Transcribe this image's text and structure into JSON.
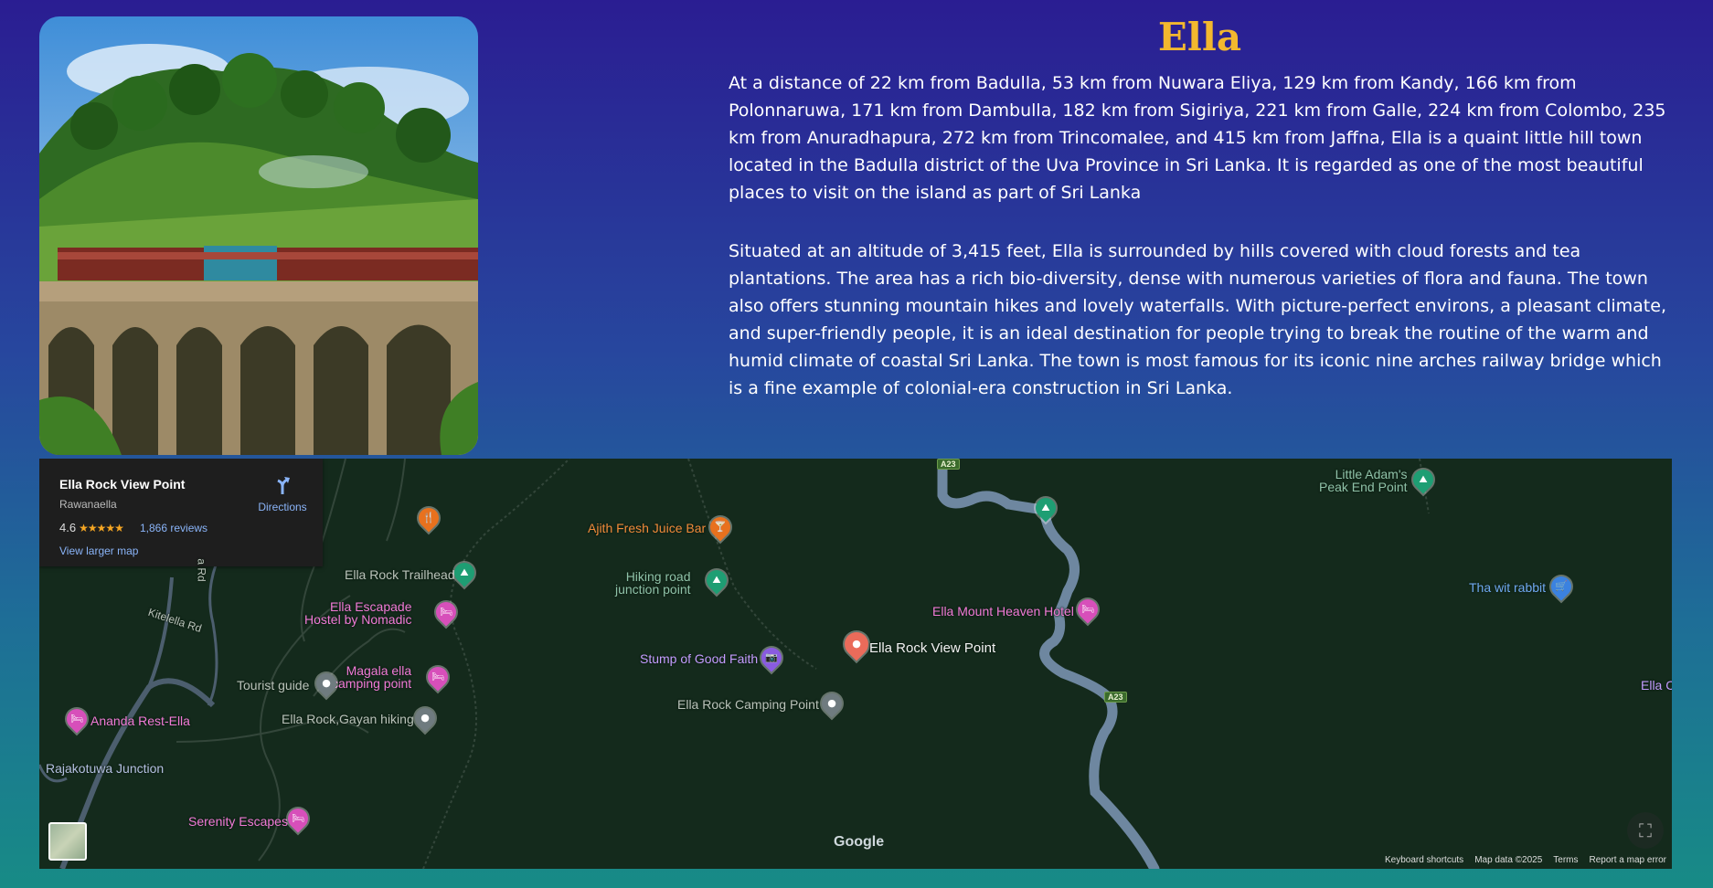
{
  "title": "Ella",
  "paragraphs": [
    "At a distance of 22 km from Badulla, 53 km from Nuwara Eliya, 129 km from Kandy, 166 km from Polonnaruwa, 171 km from Dambulla, 182 km from Sigiriya, 221 km from Galle, 224 km from Colombo, 235 km from Anuradhapura, 272 km from Trincomalee, and 415 km from Jaffna, Ella is a quaint little hill town located in the Badulla district of the Uva Province in Sri Lanka. It is regarded as one of the most beautiful places to visit on the island as part of Sri Lanka",
    "Situated at an altitude of 3,415 feet, Ella is surrounded by hills covered with cloud forests and tea plantations. The area has a rich bio-diversity, dense with numerous varieties of flora and fauna. The town also offers stunning mountain hikes and lovely waterfalls. With picture-perfect environs, a pleasant climate, and super-friendly people, it is an ideal destination for people trying to break the routine of the warm and humid climate of coastal Sri Lanka. The town is most famous for its iconic nine arches railway bridge which is a fine example of colonial-era construction in Sri Lanka."
  ],
  "colors": {
    "title": "#f3b82e",
    "text": "#ffffff",
    "map_bg": "#142a1c",
    "link": "#8ab4f8"
  },
  "map": {
    "card": {
      "place": "Ella Rock View Point",
      "area": "Rawanaella",
      "rating": "4.6",
      "stars": "★★★★★",
      "reviews": "1,866 reviews",
      "larger_map": "View larger map",
      "directions": "Directions"
    },
    "labels": {
      "selected": "Ella Rock View Point",
      "juice_bar": "Ajith Fresh Juice Bar",
      "trailhead": "Ella Rock Trailhead",
      "hostel_1": "Ella Escapade",
      "hostel_2": "Hostel by Nomadic",
      "hiking_junction_1": "Hiking road",
      "hiking_junction_2": "junction point",
      "stump": "Stump of Good Faith",
      "camping_point": "Ella Rock Camping Point",
      "magala_1": "Magala ella",
      "magala_2": "camping point",
      "tourist_guide": "Tourist guide",
      "gayan_hiking": "Ella Rock,Gayan hiking",
      "ananda": "Ananda Rest-Ella",
      "rajakotuwa": "Rajakotuwa Junction",
      "serenity": "Serenity Escapes",
      "mount_heaven": "Ella Mount Heaven Hotel",
      "little_adams_1": "Little Adam's",
      "little_adams_2": "Peak End Point",
      "tha_wit": "Tha wit rabbit",
      "ella_edge": "Ella C",
      "kitelella": "Kitelella Rd",
      "a_rd": "a Rd",
      "a23": "A23"
    },
    "icons": {
      "restaurant": "restaurant-icon",
      "hotel": "bed-icon",
      "hiking": "hiking-icon",
      "camera": "camera-icon",
      "shopping": "cart-icon",
      "generic": "place-icon",
      "drink": "cocktail-icon"
    },
    "google": "Google",
    "footer": [
      "Keyboard shortcuts",
      "Map data ©2025",
      "Terms",
      "Report a map error"
    ]
  }
}
